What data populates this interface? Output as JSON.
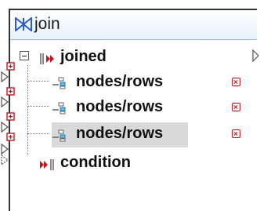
{
  "component": {
    "title": "join",
    "icon": "join-icon"
  },
  "tree": {
    "root": {
      "label": "joined",
      "icon": "joined-output-icon",
      "expanded": true
    },
    "items": [
      {
        "label": "nodes/rows",
        "icon": "node-rows-icon",
        "action_icon": "remove-icon",
        "selected": false
      },
      {
        "label": "nodes/rows",
        "icon": "node-rows-icon",
        "action_icon": "remove-icon",
        "selected": false
      },
      {
        "label": "nodes/rows",
        "icon": "node-rows-icon",
        "action_icon": "remove-icon",
        "selected": true
      }
    ],
    "condition": {
      "label": "condition",
      "icon": "condition-input-icon"
    }
  },
  "colors": {
    "title_gradient_end": "#e6f1fb",
    "accent_red": "#c0161c",
    "selection": "#d9d9d9",
    "join_icon_blue": "#2a5bd7"
  }
}
